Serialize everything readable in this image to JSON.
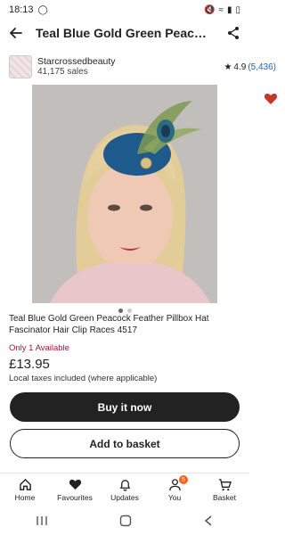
{
  "status_bar": {
    "time": "18:13"
  },
  "header": {
    "title": "Teal Blue Gold Green Peacock…"
  },
  "shop": {
    "name": "Starcrossedbeauty",
    "sales": "41,175 sales",
    "rating": "4.9",
    "review_count": "(5,436)"
  },
  "product": {
    "title": "Teal Blue Gold Green Peacock Feather Pillbox Hat Fascinator Hair Clip Races 4517",
    "availability": "Only 1 Available",
    "price": "£13.95",
    "tax_note": "Local taxes included (where applicable)",
    "image_dots": 2,
    "active_dot": 0
  },
  "actions": {
    "buy_label": "Buy it now",
    "basket_label": "Add to basket"
  },
  "nav": {
    "items": [
      {
        "label": "Home",
        "icon": "home-icon"
      },
      {
        "label": "Favourites",
        "icon": "heart-icon"
      },
      {
        "label": "Updates",
        "icon": "bell-icon"
      },
      {
        "label": "You",
        "icon": "person-icon",
        "badge": "5"
      },
      {
        "label": "Basket",
        "icon": "basket-icon"
      }
    ]
  },
  "colors": {
    "availability": "#9a1b3b",
    "badge": "#f1641e",
    "link": "#1f5fbf",
    "heart": "#c0392b"
  }
}
